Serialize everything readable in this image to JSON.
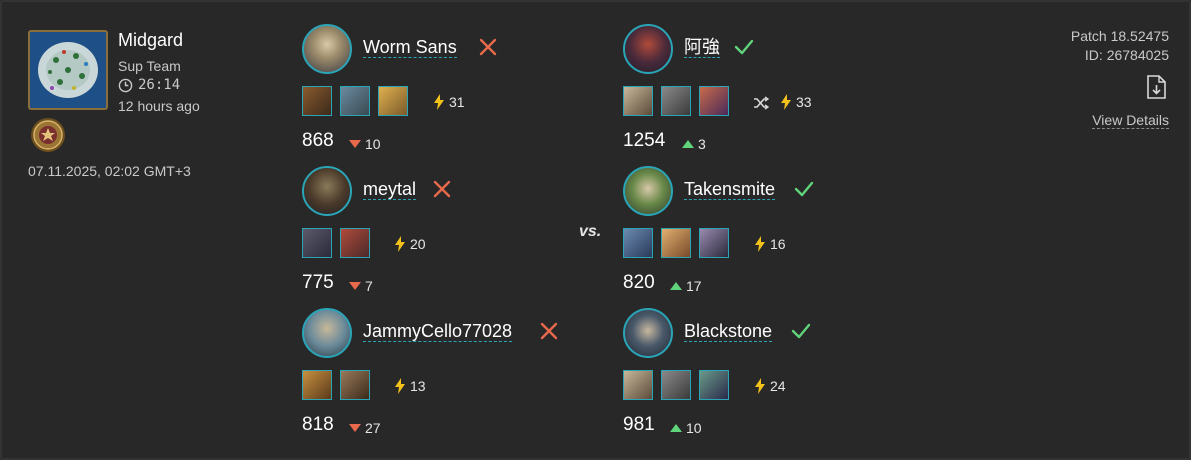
{
  "match": {
    "map_name": "Midgard",
    "mode": "Sup Team",
    "duration": "26:14",
    "ago": "12 hours ago",
    "date": "07.11.2025, 02:02 GMT+3",
    "patch": "Patch 18.52475",
    "id": "ID: 26784025",
    "view_details": "View Details",
    "vs": "vs."
  },
  "colors": {
    "loss": "#e9694c",
    "win": "#5fd47a",
    "accent": "#2aa5b8",
    "bolt": "#f2c21b"
  },
  "team_left": [
    {
      "name": "Worm Sans",
      "result": "loss",
      "gods_count": 3,
      "apm": "31",
      "elo": "868",
      "delta": "10",
      "delta_dir": "down"
    },
    {
      "name": "meytal",
      "result": "loss",
      "gods_count": 2,
      "apm": "20",
      "elo": "775",
      "delta": "7",
      "delta_dir": "down"
    },
    {
      "name": "JammyCello77028",
      "result": "loss",
      "gods_count": 2,
      "apm": "13",
      "elo": "818",
      "delta": "27",
      "delta_dir": "down"
    }
  ],
  "team_right": [
    {
      "name": "阿強",
      "result": "win",
      "gods_count": 3,
      "random": true,
      "apm": "33",
      "elo": "1254",
      "delta": "3",
      "delta_dir": "up"
    },
    {
      "name": "Takensmite",
      "result": "win",
      "gods_count": 3,
      "apm": "16",
      "elo": "820",
      "delta": "17",
      "delta_dir": "up"
    },
    {
      "name": "Blackstone",
      "result": "win",
      "gods_count": 3,
      "apm": "24",
      "elo": "981",
      "delta": "10",
      "delta_dir": "up"
    }
  ]
}
